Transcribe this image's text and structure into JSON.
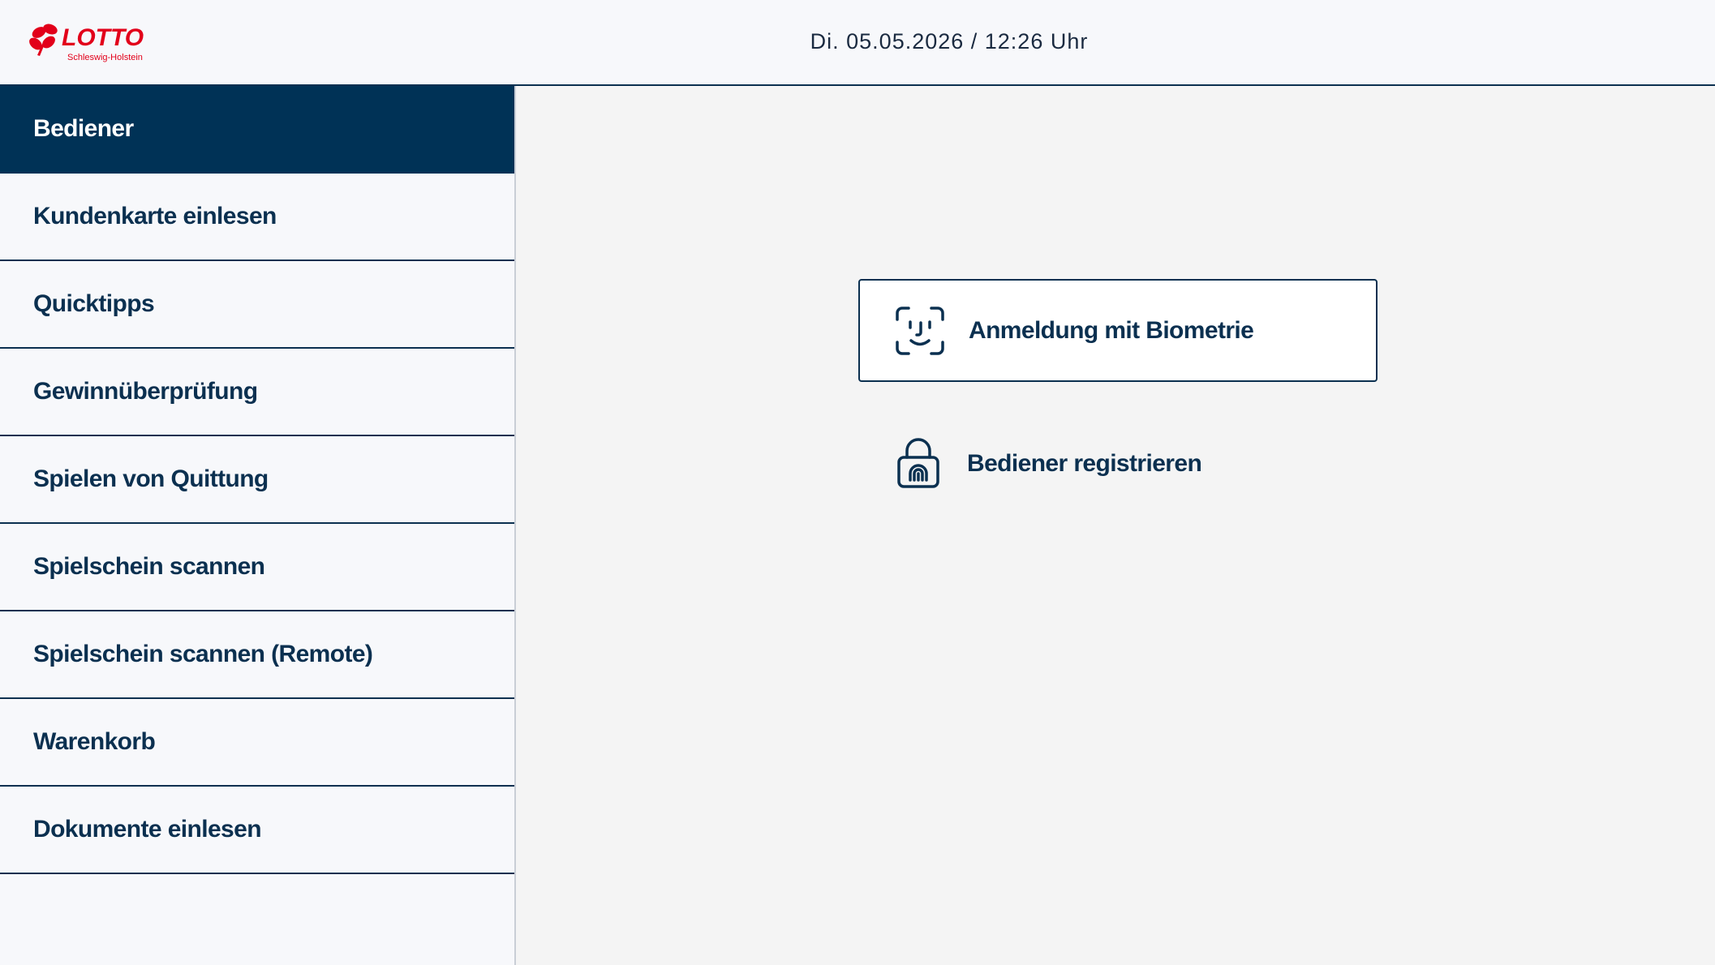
{
  "header": {
    "logo_text": "LOTTO",
    "logo_subtext": "Schleswig-Holstein",
    "datetime": "Di. 05.05.2026 / 12:26 Uhr"
  },
  "sidebar": {
    "items": [
      {
        "label": "Bediener",
        "active": true
      },
      {
        "label": "Kundenkarte einlesen"
      },
      {
        "label": "Quicktipps"
      },
      {
        "label": "Gewinnüberprüfung"
      },
      {
        "label": "Spielen von Quittung"
      },
      {
        "label": "Spielschein scannen"
      },
      {
        "label": "Spielschein scannen (Remote)"
      },
      {
        "label": "Warenkorb"
      },
      {
        "label": "Dokumente einlesen"
      }
    ]
  },
  "main": {
    "biometric_button": {
      "label": "Anmeldung mit Biometrie",
      "icon": "face-id-icon"
    },
    "register_button": {
      "label": "Bediener registrieren",
      "icon": "fingerprint-lock-icon"
    }
  },
  "colors": {
    "primary": "#003256",
    "logo_red": "#e2001a",
    "background": "#f4f4f4",
    "sidebar_bg": "#f7f8fb"
  }
}
